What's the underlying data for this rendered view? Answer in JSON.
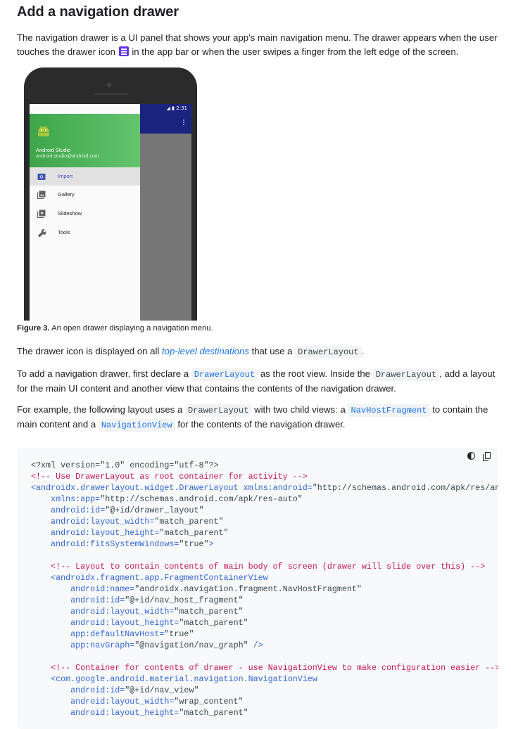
{
  "heading": "Add a navigation drawer",
  "intro": {
    "part1": "The navigation drawer is a UI panel that shows your app's main navigation menu. The drawer appears when the user touches the drawer icon",
    "part2": "in the app bar or when the user swipes a finger from the left edge of the screen."
  },
  "phone": {
    "status_time": "2:31",
    "drawer_name": "Android Studio",
    "drawer_email": "android.studio@android.com",
    "menu": [
      {
        "label": "Import",
        "icon": "camera-icon",
        "active": true
      },
      {
        "label": "Gallery",
        "icon": "gallery-icon",
        "active": false
      },
      {
        "label": "Slideshow",
        "icon": "slideshow-icon",
        "active": false
      },
      {
        "label": "Tools",
        "icon": "wrench-icon",
        "active": false
      }
    ]
  },
  "caption": {
    "label": "Figure 3.",
    "text": "An open drawer displaying a navigation menu."
  },
  "para1": {
    "pre": "The drawer icon is displayed on all",
    "link": "top-level destinations",
    "mid": "that use a",
    "code": "DrawerLayout",
    "post": "."
  },
  "para2": {
    "pre": "To add a navigation drawer, first declare a",
    "code1": "DrawerLayout",
    "mid": "as the root view. Inside the",
    "code2": "DrawerLayout",
    "post": ", add a layout for the main UI content and another view that contains the contents of the navigation drawer."
  },
  "para3": {
    "pre": "For example, the following layout uses a",
    "code1": "DrawerLayout",
    "mid1": "with two child views: a",
    "code2": "NavHostFragment",
    "mid2": "to contain the main content and a",
    "code3": "NavigationView",
    "post": "for the contents of the navigation drawer."
  },
  "code_lines": [
    [
      {
        "t": "<?xml version=\"1.0\" encoding=\"utf-8\"?>",
        "c": "plain"
      }
    ],
    [
      {
        "t": "<!-- Use DrawerLayout as root container for activity -->",
        "c": "com"
      }
    ],
    [
      {
        "t": "<androidx.drawerlayout.widget.DrawerLayout ",
        "c": "tag"
      },
      {
        "t": "xmlns:android=",
        "c": "attr"
      },
      {
        "t": "\"http://schemas.android.com/apk/res/android\"",
        "c": "plain"
      }
    ],
    [
      {
        "t": "    xmlns:app=",
        "c": "attr"
      },
      {
        "t": "\"http://schemas.android.com/apk/res-auto\"",
        "c": "plain"
      }
    ],
    [
      {
        "t": "    android:id=",
        "c": "attr"
      },
      {
        "t": "\"@+id/drawer_layout\"",
        "c": "plain"
      }
    ],
    [
      {
        "t": "    android:layout_width=",
        "c": "attr"
      },
      {
        "t": "\"match_parent\"",
        "c": "plain"
      }
    ],
    [
      {
        "t": "    android:layout_height=",
        "c": "attr"
      },
      {
        "t": "\"match_parent\"",
        "c": "plain"
      }
    ],
    [
      {
        "t": "    android:fitsSystemWindows=",
        "c": "attr"
      },
      {
        "t": "\"true\"",
        "c": "plain"
      },
      {
        "t": ">",
        "c": "tag"
      }
    ],
    [
      {
        "t": "",
        "c": "plain"
      }
    ],
    [
      {
        "t": "    <!-- Layout to contain contents of main body of screen (drawer will slide over this) -->",
        "c": "com"
      }
    ],
    [
      {
        "t": "    <androidx.fragment.app.FragmentContainerView",
        "c": "tag"
      }
    ],
    [
      {
        "t": "        android:name=",
        "c": "attr"
      },
      {
        "t": "\"androidx.navigation.fragment.NavHostFragment\"",
        "c": "plain"
      }
    ],
    [
      {
        "t": "        android:id=",
        "c": "attr"
      },
      {
        "t": "\"@+id/nav_host_fragment\"",
        "c": "plain"
      }
    ],
    [
      {
        "t": "        android:layout_width=",
        "c": "attr"
      },
      {
        "t": "\"match_parent\"",
        "c": "plain"
      }
    ],
    [
      {
        "t": "        android:layout_height=",
        "c": "attr"
      },
      {
        "t": "\"match_parent\"",
        "c": "plain"
      }
    ],
    [
      {
        "t": "        app:defaultNavHost=",
        "c": "attr"
      },
      {
        "t": "\"true\"",
        "c": "plain"
      }
    ],
    [
      {
        "t": "        app:navGraph=",
        "c": "attr"
      },
      {
        "t": "\"@navigation/nav_graph\"",
        "c": "plain"
      },
      {
        "t": " />",
        "c": "tag"
      }
    ],
    [
      {
        "t": "",
        "c": "plain"
      }
    ],
    [
      {
        "t": "    <!-- Container for contents of drawer - use NavigationView to make configuration easier -->",
        "c": "com"
      }
    ],
    [
      {
        "t": "    <com.google.android.material.navigation.NavigationView",
        "c": "tag"
      }
    ],
    [
      {
        "t": "        android:id=",
        "c": "attr"
      },
      {
        "t": "\"@+id/nav_view\"",
        "c": "plain"
      }
    ],
    [
      {
        "t": "        android:layout_width=",
        "c": "attr"
      },
      {
        "t": "\"wrap_content\"",
        "c": "plain"
      }
    ],
    [
      {
        "t": "        android:layout_height=",
        "c": "attr"
      },
      {
        "t": "\"match_parent\"",
        "c": "plain"
      }
    ]
  ]
}
